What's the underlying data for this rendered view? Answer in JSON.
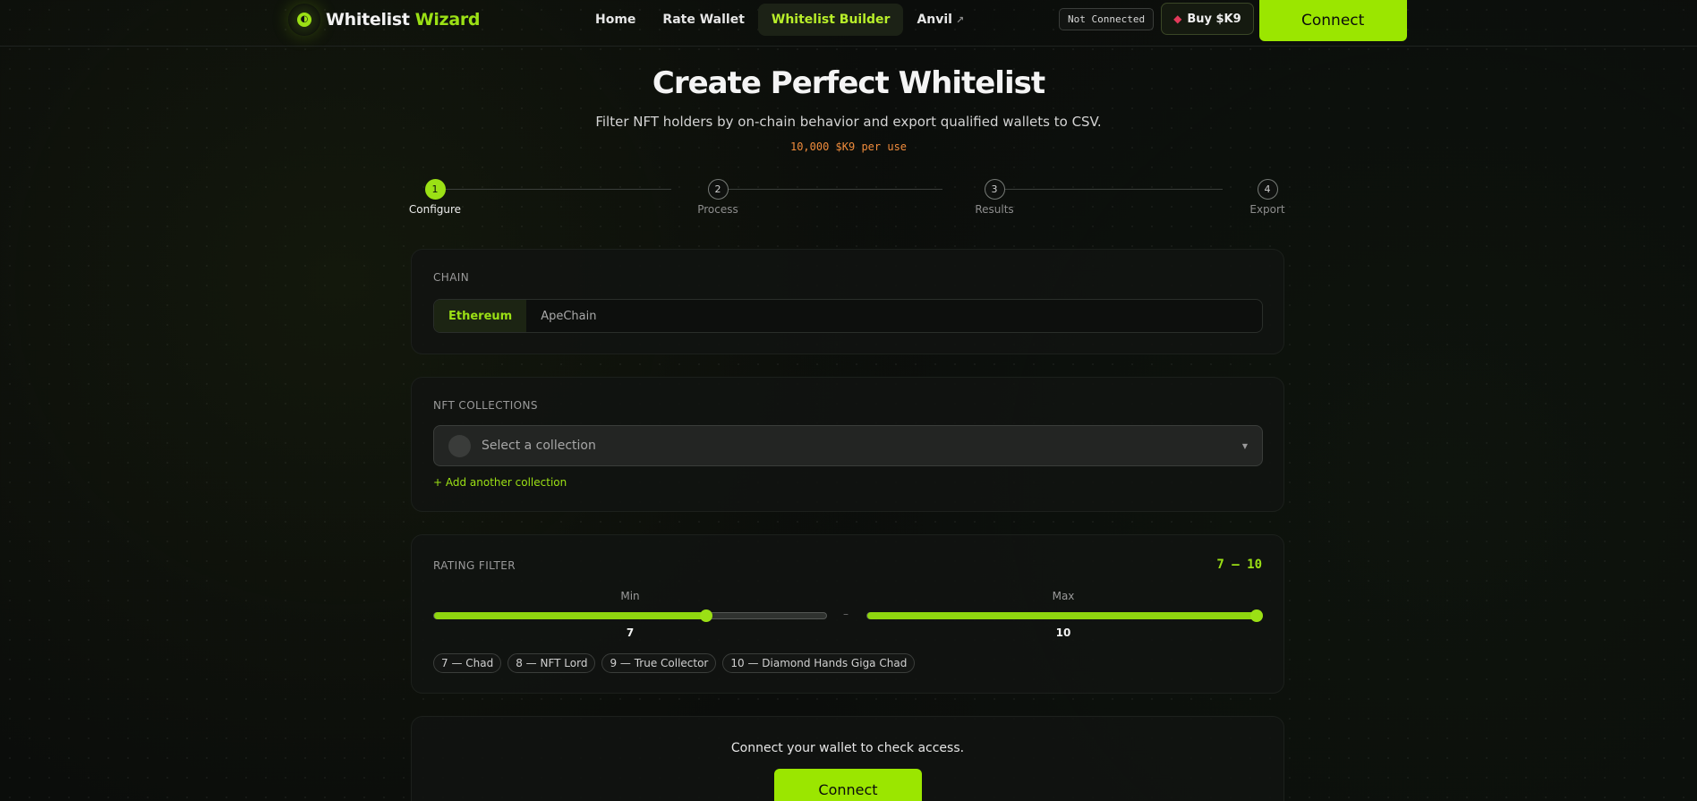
{
  "nav": {
    "brand_word1": "Whitelist",
    "brand_word2": "Wizard",
    "logo_icon": "wizard-eye-icon",
    "links": [
      {
        "label": "Home"
      },
      {
        "label": "Rate Wallet"
      },
      {
        "label": "Whitelist Builder",
        "active": true
      },
      {
        "label": "Anvil",
        "external": true
      }
    ],
    "status": "Not Connected",
    "buy_label": "Buy $K9",
    "connect_label": "Connect"
  },
  "hero": {
    "title": "Create Perfect Whitelist",
    "subtitle": "Filter NFT holders by on-chain behavior and export qualified wallets to CSV.",
    "price": "10,000 $K9 per use"
  },
  "steps": [
    {
      "num": "1",
      "label": "Configure",
      "active": true
    },
    {
      "num": "2",
      "label": "Process"
    },
    {
      "num": "3",
      "label": "Results"
    },
    {
      "num": "4",
      "label": "Export"
    }
  ],
  "chain": {
    "label": "CHAIN",
    "options": [
      "Ethereum",
      "ApeChain"
    ],
    "selected": "Ethereum"
  },
  "collections": {
    "label": "NFT COLLECTIONS",
    "placeholder": "Select a collection",
    "add_label": "+ Add another collection"
  },
  "rating": {
    "label": "RATING FILTER",
    "range_text": "7 – 10",
    "min_label": "Min",
    "max_label": "Max",
    "min_value": "7",
    "max_value": "10",
    "min_fraction": 0.694,
    "max_fraction": 1.0,
    "separator": "–",
    "chips": [
      "7 — Chad",
      "8 — NFT Lord",
      "9 — True Collector",
      "10 — Diamond Hands Giga Chad"
    ]
  },
  "access": {
    "message": "Connect your wallet to check access.",
    "connect_label": "Connect"
  },
  "colors": {
    "accent": "#9be015",
    "price": "#f08c3c",
    "background": "#0b0d0b"
  }
}
